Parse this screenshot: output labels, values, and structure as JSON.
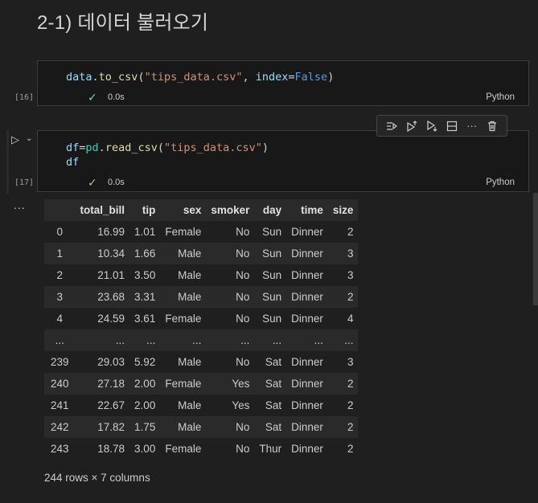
{
  "heading": "2-1) 데이터 불러오기",
  "cell1": {
    "exec_count": "[16]",
    "code": {
      "var": "data",
      "dot1": ".",
      "fn": "to_csv",
      "open": "(",
      "str": "\"tips_data.csv\"",
      "comma": ", ",
      "kw": "index",
      "eq": "=",
      "false": "False",
      "close": ")"
    },
    "duration": "0.0s",
    "language": "Python"
  },
  "cell2": {
    "exec_count": "[17]",
    "code_line1": {
      "var": "df",
      "eq": "=",
      "mod": "pd",
      "dot": ".",
      "fn": "read_csv",
      "open": "(",
      "str": "\"tips_data.csv\"",
      "close": ")"
    },
    "code_line2": "df",
    "duration": "0.0s",
    "language": "Python"
  },
  "toolbar": {
    "icons": [
      "run-by-line-icon",
      "execute-above-icon",
      "execute-below-icon",
      "split-cell-icon",
      "more-actions-icon",
      "delete-cell-icon"
    ]
  },
  "output": {
    "dots": "...",
    "table": {
      "columns": [
        "",
        "total_bill",
        "tip",
        "sex",
        "smoker",
        "day",
        "time",
        "size"
      ],
      "rows": [
        [
          "0",
          "16.99",
          "1.01",
          "Female",
          "No",
          "Sun",
          "Dinner",
          "2"
        ],
        [
          "1",
          "10.34",
          "1.66",
          "Male",
          "No",
          "Sun",
          "Dinner",
          "3"
        ],
        [
          "2",
          "21.01",
          "3.50",
          "Male",
          "No",
          "Sun",
          "Dinner",
          "3"
        ],
        [
          "3",
          "23.68",
          "3.31",
          "Male",
          "No",
          "Sun",
          "Dinner",
          "2"
        ],
        [
          "4",
          "24.59",
          "3.61",
          "Female",
          "No",
          "Sun",
          "Dinner",
          "4"
        ],
        [
          "...",
          "...",
          "...",
          "...",
          "...",
          "...",
          "...",
          "..."
        ],
        [
          "239",
          "29.03",
          "5.92",
          "Male",
          "No",
          "Sat",
          "Dinner",
          "3"
        ],
        [
          "240",
          "27.18",
          "2.00",
          "Female",
          "Yes",
          "Sat",
          "Dinner",
          "2"
        ],
        [
          "241",
          "22.67",
          "2.00",
          "Male",
          "Yes",
          "Sat",
          "Dinner",
          "2"
        ],
        [
          "242",
          "17.82",
          "1.75",
          "Male",
          "No",
          "Sat",
          "Dinner",
          "2"
        ],
        [
          "243",
          "18.78",
          "3.00",
          "Female",
          "No",
          "Thur",
          "Dinner",
          "2"
        ]
      ]
    },
    "summary": "244 rows × 7 columns"
  }
}
